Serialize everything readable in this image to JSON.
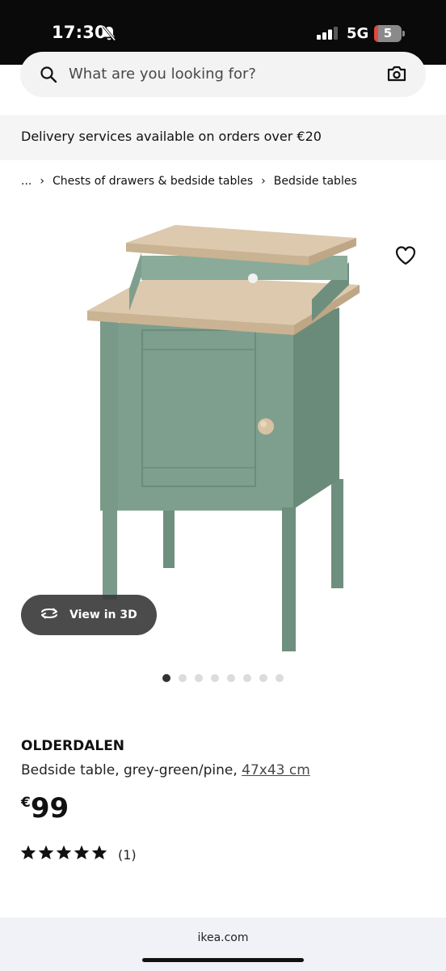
{
  "status_bar": {
    "time": "17:30",
    "network": "5G",
    "battery_level": "5",
    "icons": [
      "bell-slash-icon",
      "signal-icon"
    ]
  },
  "search": {
    "placeholder": "What are you looking for?",
    "icon": "search-icon",
    "camera_icon": "camera-icon"
  },
  "banner": {
    "delivery_text": "Delivery services available on orders over €20"
  },
  "breadcrumb": {
    "ellipsis": "...",
    "items": [
      "Chests of drawers & bedside tables",
      "Bedside tables"
    ]
  },
  "gallery": {
    "view_3d_label": "View in 3D",
    "image_count": 8,
    "active_index": 0,
    "favourite_icon": "heart-outline-icon",
    "colors": {
      "furniture_green": "#7f9f8e",
      "top_wood": "#dcc9ae"
    }
  },
  "product": {
    "name": "OLDERDALEN",
    "description": "Bedside table, grey-green/pine,",
    "size": "47x43 cm",
    "currency": "€",
    "price": "99",
    "rating": 5,
    "review_count": "(1)"
  },
  "browser": {
    "url": "ikea.com"
  }
}
